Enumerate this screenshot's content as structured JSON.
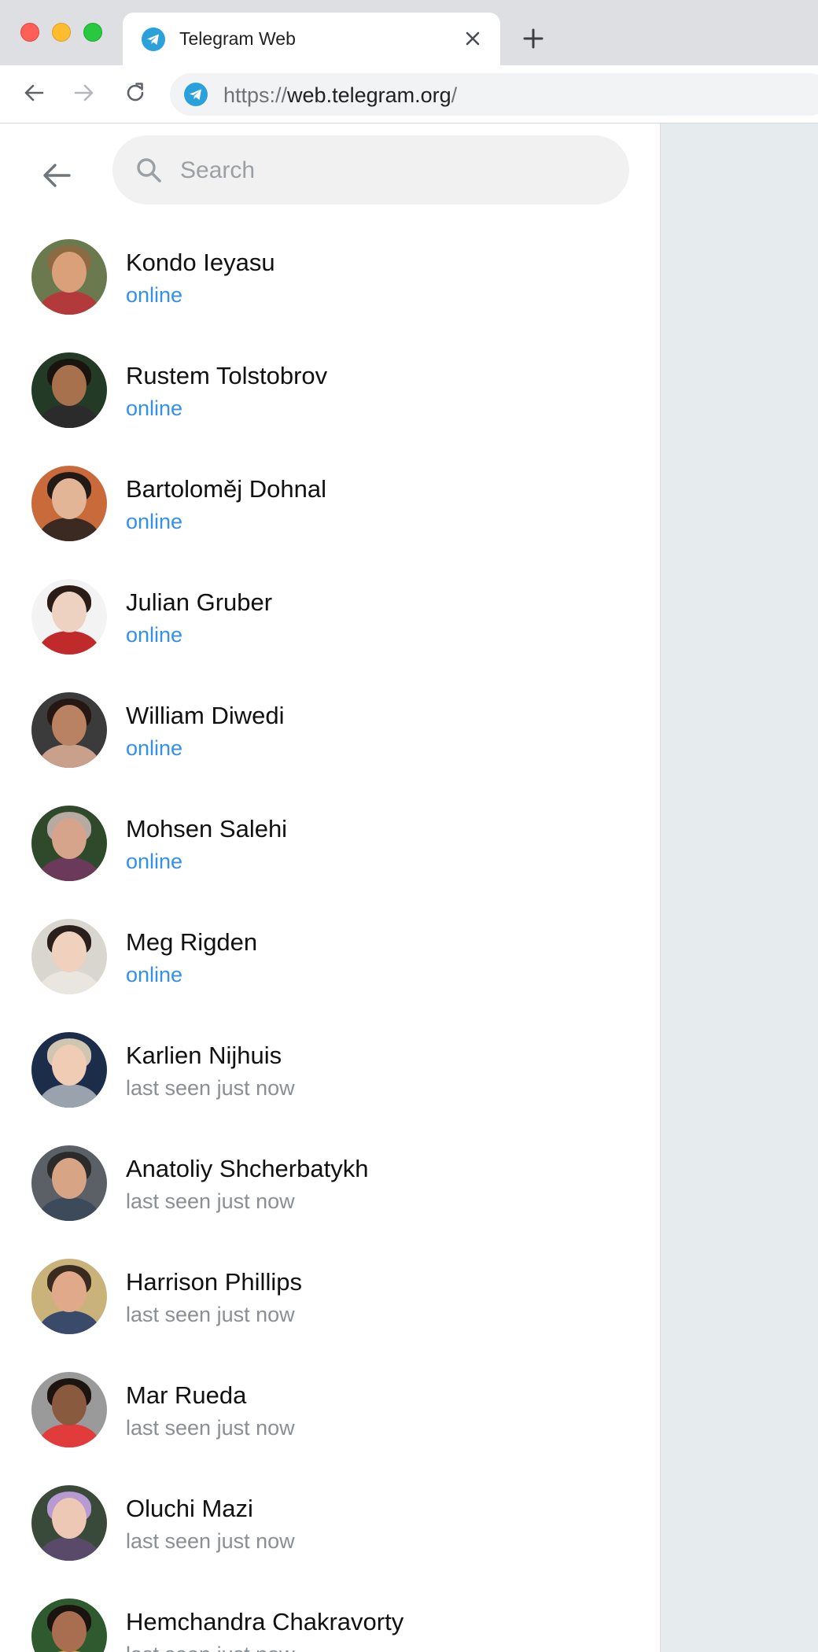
{
  "browser": {
    "tab_title": "Telegram Web",
    "url_scheme": "https://",
    "url_host": "web.telegram.org",
    "url_path": "/",
    "accent": "#2aa1da"
  },
  "search": {
    "placeholder": "Search"
  },
  "contacts": [
    {
      "name": "Kondo Ieyasu",
      "status": "online",
      "online": true,
      "avatar_bg": "#6a7a4e",
      "skin": "#d9a07a",
      "hair": "#8b6a44",
      "cloth": "#b23a3a"
    },
    {
      "name": "Rustem Tolstobrov",
      "status": "online",
      "online": true,
      "avatar_bg": "#233a26",
      "skin": "#a8714e",
      "hair": "#1a1410",
      "cloth": "#2b2b2b"
    },
    {
      "name": "Bartoloměj Dohnal",
      "status": "online",
      "online": true,
      "avatar_bg": "#c96a3a",
      "skin": "#e3b597",
      "hair": "#231915",
      "cloth": "#3a2a22"
    },
    {
      "name": "Julian Gruber",
      "status": "online",
      "online": true,
      "avatar_bg": "#f3f3f3",
      "skin": "#edd2c1",
      "hair": "#2a1d17",
      "cloth": "#c02a2a"
    },
    {
      "name": "William Diwedi",
      "status": "online",
      "online": true,
      "avatar_bg": "#3b3b3b",
      "skin": "#b98262",
      "hair": "#251814",
      "cloth": "#c9a089"
    },
    {
      "name": "Mohsen Salehi",
      "status": "online",
      "online": true,
      "avatar_bg": "#2e4a2a",
      "skin": "#d6a38b",
      "hair": "#b6aba3",
      "cloth": "#6b3a5a"
    },
    {
      "name": "Meg Rigden",
      "status": "online",
      "online": true,
      "avatar_bg": "#d9d6cf",
      "skin": "#efd1bd",
      "hair": "#2a1f1a",
      "cloth": "#e9e6df"
    },
    {
      "name": "Karlien Nijhuis",
      "status": "last seen just now",
      "online": false,
      "avatar_bg": "#1c2d4a",
      "skin": "#f0ccb4",
      "hair": "#cfc5b0",
      "cloth": "#9aa3ad"
    },
    {
      "name": "Anatoliy Shcherbatykh",
      "status": "last seen just now",
      "online": false,
      "avatar_bg": "#5b6066",
      "skin": "#d7a486",
      "hair": "#2b2b2b",
      "cloth": "#3c4a5a"
    },
    {
      "name": "Harrison Phillips",
      "status": "last seen just now",
      "online": false,
      "avatar_bg": "#c9b37a",
      "skin": "#e0a98a",
      "hair": "#3a2a1f",
      "cloth": "#3a4a6a"
    },
    {
      "name": "Mar Rueda",
      "status": "last seen just now",
      "online": false,
      "avatar_bg": "#9a9a9a",
      "skin": "#8a5a3e",
      "hair": "#1c1410",
      "cloth": "#e23b3b"
    },
    {
      "name": "Oluchi Mazi",
      "status": "last seen just now",
      "online": false,
      "avatar_bg": "#3a4a3a",
      "skin": "#edc9b5",
      "hair": "#b69ad0",
      "cloth": "#5a4a6a"
    },
    {
      "name": "Hemchandra Chakravorty",
      "status": "last seen just now",
      "online": false,
      "avatar_bg": "#2f5a2f",
      "skin": "#a86e4f",
      "hair": "#1a1410",
      "cloth": "#d4a43a"
    }
  ]
}
